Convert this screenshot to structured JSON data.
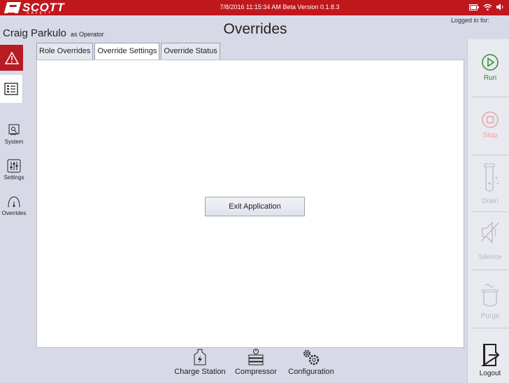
{
  "app": {
    "brand": "SCOTT",
    "brand_sub": "SAFETY",
    "datetime_version": "7/8/2016 11:15:34 AM  Beta Version 0.1.8.3"
  },
  "header": {
    "logged_in_for": "Logged in for:",
    "user_name": "Craig Parkulo",
    "user_role": "as Operator",
    "page_title": "Overrides"
  },
  "left_nav": {
    "items": [
      {
        "label": "System",
        "icon": "system-icon"
      },
      {
        "label": "Settings",
        "icon": "sliders-icon"
      },
      {
        "label": "Overrides",
        "icon": "gauge-icon"
      }
    ]
  },
  "tabs": [
    {
      "label": "Role Overrides",
      "active": false
    },
    {
      "label": "Override Settings",
      "active": true
    },
    {
      "label": "Override Status",
      "active": false
    }
  ],
  "main": {
    "exit_button": "Exit Application"
  },
  "bottom_nav": {
    "items": [
      {
        "label": "Charge Station",
        "icon": "charge-station-icon"
      },
      {
        "label": "Compressor",
        "icon": "compressor-icon"
      },
      {
        "label": "Configuration",
        "icon": "gears-icon"
      }
    ]
  },
  "right_actions": {
    "run": "Run",
    "stop": "Stop",
    "drain": "Drain",
    "silence": "Silence",
    "purge": "Purge",
    "logout": "Logout"
  },
  "colors": {
    "brand_red": "#c0171d",
    "run_green": "#2e8b2e",
    "disabled_gray": "#b9b9bf"
  }
}
